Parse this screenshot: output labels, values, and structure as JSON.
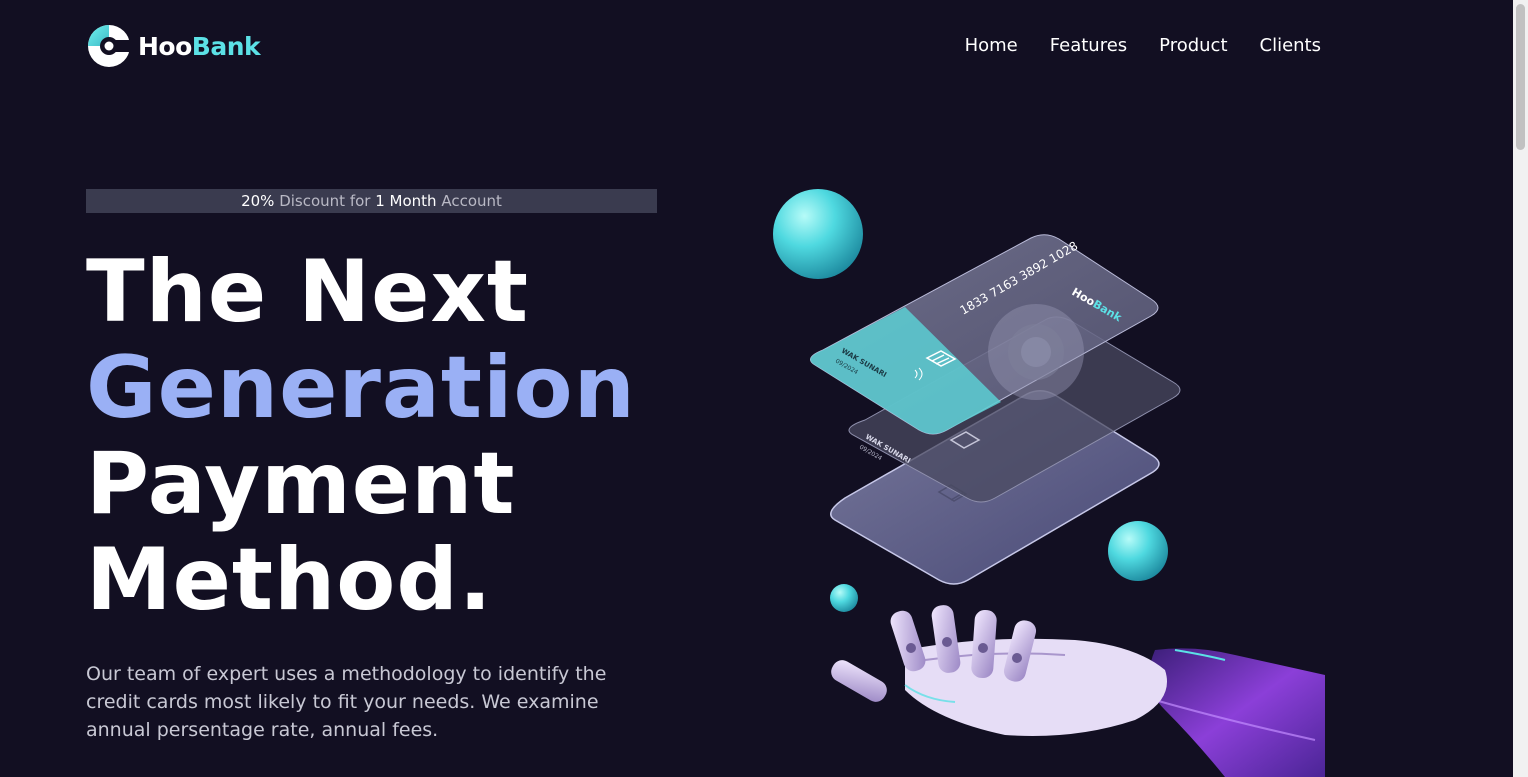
{
  "header": {
    "logo": {
      "part1": "Hoo",
      "part2": "Bank"
    },
    "nav": [
      {
        "label": "Home"
      },
      {
        "label": "Features"
      },
      {
        "label": "Product"
      },
      {
        "label": "Clients"
      }
    ]
  },
  "hero": {
    "promo": {
      "percent": "20%",
      "text1": "Discount",
      "text2": "for",
      "duration": "1 Month",
      "text3": "Account"
    },
    "headline": {
      "line1": "The Next",
      "line2": "Generation",
      "line3": "Payment",
      "line4": "Method."
    },
    "description": "Our team of expert uses a methodology to identify the credit cards most likely to fit your needs. We examine annual persentage rate, annual fees.",
    "card": {
      "number": "1833 7163 3892 1028",
      "brand_part1": "Hoo",
      "brand_part2": "Bank",
      "holder": "WAK SUNARI",
      "expiry": "09/2024"
    }
  },
  "colors": {
    "background": "#120f22",
    "accent_cyan": "#5ce1e6",
    "accent_blue": "#9ab0f5"
  }
}
